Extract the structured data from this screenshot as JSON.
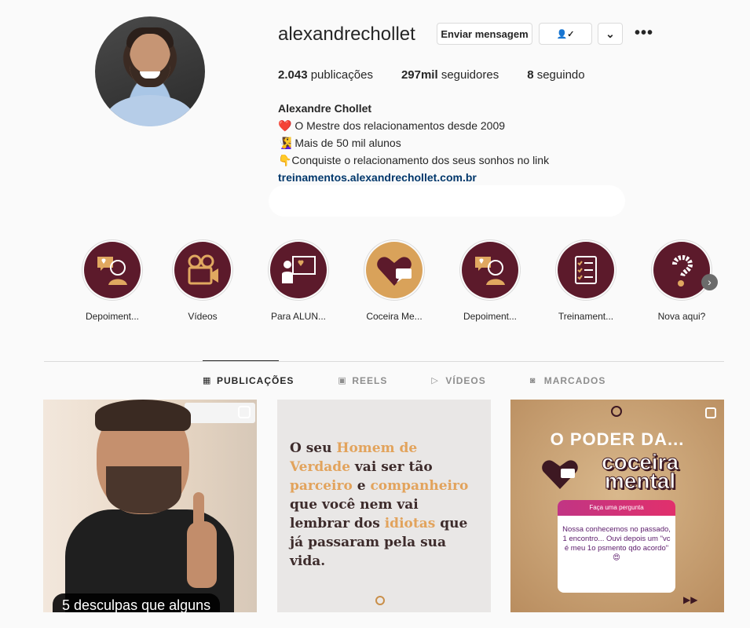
{
  "profile": {
    "username": "alexandrechollet",
    "message_button": "Enviar mensagem",
    "follow_icon": "person-check-icon",
    "dropdown_icon": "chevron-down-icon",
    "more_icon": "more-icon",
    "more_glyph": "•••",
    "follow_glyph": "👤✓",
    "dropdown_glyph": "⌄"
  },
  "stats": {
    "posts_count": "2.043",
    "posts_label": "publicações",
    "followers_count": "297mil",
    "followers_label": "seguidores",
    "following_count": "8",
    "following_label": "seguindo"
  },
  "bio": {
    "name": "Alexandre Chollet",
    "line1": "❤️ O Mestre dos relacionamentos desde 2009",
    "line2": "🧏‍♀️ Mais de 50 mil alunos",
    "line3": "👇Conquiste o relacionamento dos seus sonhos no link",
    "link": "treinamentos.alexandrechollet.com.br"
  },
  "highlights": [
    {
      "label": "Depoiment...",
      "icon": "heart-woman-icon"
    },
    {
      "label": "Vídeos",
      "icon": "camera-icon"
    },
    {
      "label": "Para ALUN...",
      "icon": "teacher-icon"
    },
    {
      "label": "Coceira Me...",
      "icon": "heart-chat-icon"
    },
    {
      "label": "Depoiment...",
      "icon": "heart-woman-icon"
    },
    {
      "label": "Treinament...",
      "icon": "checklist-icon"
    },
    {
      "label": "Nova aqui?",
      "icon": "question-icon"
    }
  ],
  "tabs": [
    {
      "label": "PUBLICAÇÕES",
      "icon": "grid-icon",
      "glyph": "▦",
      "active": true
    },
    {
      "label": "REELS",
      "icon": "reels-icon",
      "glyph": "▣",
      "active": false
    },
    {
      "label": "VÍDEOS",
      "icon": "play-icon",
      "glyph": "▷",
      "active": false
    },
    {
      "label": "MARCADOS",
      "icon": "tag-icon",
      "glyph": "◙",
      "active": false
    }
  ],
  "posts": {
    "post1_caption": "5 desculpas que alguns",
    "post2": {
      "t1": "O seu ",
      "h1": "Homem de Verdade",
      "t2": " vai ser tão ",
      "h2": "parceiro",
      "t3": " e ",
      "h3": "companheiro",
      "t4": " que você nem vai lembrar dos ",
      "h4": "idiotas",
      "t5": " que já passaram pela sua vida."
    },
    "post3": {
      "title": "O PODER DA...",
      "big": "coceira mental",
      "card_header": "Faça uma pergunta",
      "card_body": "Nossa conhecemos no passado, 1 encontro... Ouvi depois um \"vc é meu 1o psmento qdo acordo\" 😍"
    }
  },
  "colors": {
    "highlight_maroon": "#5c1a2b",
    "highlight_tan": "#d9a25a",
    "link_blue": "#00376b"
  }
}
